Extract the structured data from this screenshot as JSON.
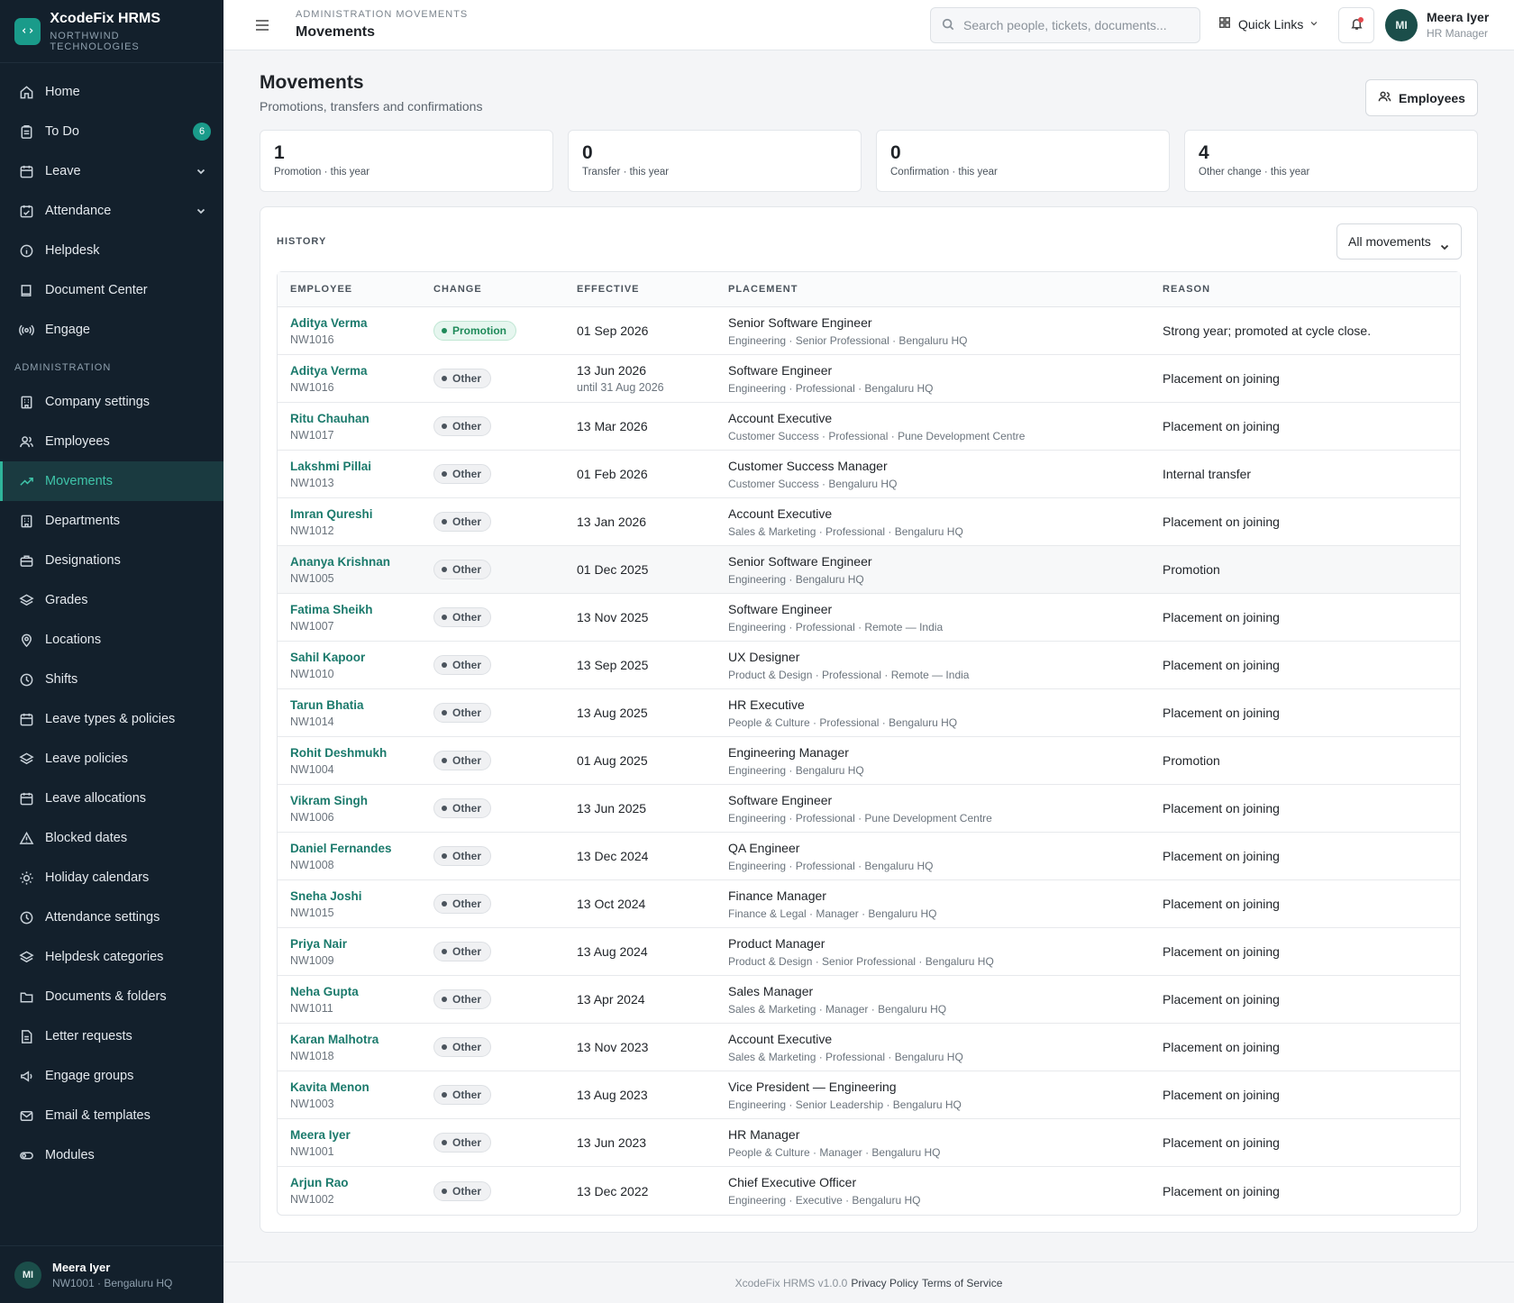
{
  "brand": {
    "name": "XcodeFix HRMS",
    "org": "NORTHWIND TECHNOLOGIES",
    "logo": "‹›"
  },
  "sidebar": {
    "items": [
      {
        "label": "Home",
        "icon": "home-icon"
      },
      {
        "label": "To Do",
        "icon": "clipboard-icon",
        "badge": "6"
      },
      {
        "label": "Leave",
        "icon": "calendar-icon",
        "expandable": true
      },
      {
        "label": "Attendance",
        "icon": "calendar-check-icon",
        "expandable": true
      },
      {
        "label": "Helpdesk",
        "icon": "info-icon"
      },
      {
        "label": "Document Center",
        "icon": "book-icon"
      },
      {
        "label": "Engage",
        "icon": "broadcast-icon"
      }
    ],
    "section_label": "ADMINISTRATION",
    "admin_items": [
      {
        "label": "Company settings",
        "icon": "building-icon"
      },
      {
        "label": "Employees",
        "icon": "users-icon"
      },
      {
        "label": "Movements",
        "icon": "trending-up-icon",
        "active": true
      },
      {
        "label": "Departments",
        "icon": "building-icon"
      },
      {
        "label": "Designations",
        "icon": "briefcase-icon"
      },
      {
        "label": "Grades",
        "icon": "layers-icon"
      },
      {
        "label": "Locations",
        "icon": "map-pin-icon"
      },
      {
        "label": "Shifts",
        "icon": "clock-icon"
      },
      {
        "label": "Leave types & policies",
        "icon": "calendar-icon"
      },
      {
        "label": "Leave policies",
        "icon": "layers-icon"
      },
      {
        "label": "Leave allocations",
        "icon": "calendar-icon"
      },
      {
        "label": "Blocked dates",
        "icon": "alert-triangle-icon"
      },
      {
        "label": "Holiday calendars",
        "icon": "sun-icon"
      },
      {
        "label": "Attendance settings",
        "icon": "clock-icon"
      },
      {
        "label": "Helpdesk categories",
        "icon": "layers-icon"
      },
      {
        "label": "Documents & folders",
        "icon": "folder-icon"
      },
      {
        "label": "Letter requests",
        "icon": "file-icon"
      },
      {
        "label": "Engage groups",
        "icon": "megaphone-icon"
      },
      {
        "label": "Email & templates",
        "icon": "mail-icon"
      },
      {
        "label": "Modules",
        "icon": "toggle-icon"
      }
    ],
    "footer": {
      "initials": "MI",
      "name": "Meera Iyer",
      "sub": "NW1001 · Bengaluru HQ"
    }
  },
  "topbar": {
    "breadcrumb": "ADMINISTRATION MOVEMENTS",
    "title": "Movements",
    "search_placeholder": "Search people, tickets, documents...",
    "quick_links": "Quick Links",
    "user": {
      "initials": "MI",
      "name": "Meera Iyer",
      "role": "HR Manager"
    }
  },
  "page": {
    "title": "Movements",
    "subtitle": "Promotions, transfers and confirmations",
    "employees_button": "Employees"
  },
  "stats": [
    {
      "value": "1",
      "label": "Promotion · this year"
    },
    {
      "value": "0",
      "label": "Transfer · this year"
    },
    {
      "value": "0",
      "label": "Confirmation · this year"
    },
    {
      "value": "4",
      "label": "Other change · this year"
    }
  ],
  "history": {
    "heading": "HISTORY",
    "filter": "All movements",
    "columns": [
      "EMPLOYEE",
      "CHANGE",
      "EFFECTIVE",
      "PLACEMENT",
      "REASON"
    ],
    "rows": [
      {
        "name": "Aditya Verma",
        "id": "NW1016",
        "change": "Promotion",
        "date": "01 Sep 2026",
        "date_sub": "",
        "title": "Senior Software Engineer",
        "placement": "Engineering · Senior Professional · Bengaluru HQ",
        "reason": "Strong year; promoted at cycle close."
      },
      {
        "name": "Aditya Verma",
        "id": "NW1016",
        "change": "Other",
        "date": "13 Jun 2026",
        "date_sub": "until 31 Aug 2026",
        "title": "Software Engineer",
        "placement": "Engineering · Professional · Bengaluru HQ",
        "reason": "Placement on joining"
      },
      {
        "name": "Ritu Chauhan",
        "id": "NW1017",
        "change": "Other",
        "date": "13 Mar 2026",
        "date_sub": "",
        "title": "Account Executive",
        "placement": "Customer Success · Professional · Pune Development Centre",
        "reason": "Placement on joining"
      },
      {
        "name": "Lakshmi Pillai",
        "id": "NW1013",
        "change": "Other",
        "date": "01 Feb 2026",
        "date_sub": "",
        "title": "Customer Success Manager",
        "placement": "Customer Success · Bengaluru HQ",
        "reason": "Internal transfer"
      },
      {
        "name": "Imran Qureshi",
        "id": "NW1012",
        "change": "Other",
        "date": "13 Jan 2026",
        "date_sub": "",
        "title": "Account Executive",
        "placement": "Sales & Marketing · Professional · Bengaluru HQ",
        "reason": "Placement on joining"
      },
      {
        "name": "Ananya Krishnan",
        "id": "NW1005",
        "change": "Other",
        "date": "01 Dec 2025",
        "date_sub": "",
        "title": "Senior Software Engineer",
        "placement": "Engineering · Bengaluru HQ",
        "reason": "Promotion"
      },
      {
        "name": "Fatima Sheikh",
        "id": "NW1007",
        "change": "Other",
        "date": "13 Nov 2025",
        "date_sub": "",
        "title": "Software Engineer",
        "placement": "Engineering · Professional · Remote — India",
        "reason": "Placement on joining"
      },
      {
        "name": "Sahil Kapoor",
        "id": "NW1010",
        "change": "Other",
        "date": "13 Sep 2025",
        "date_sub": "",
        "title": "UX Designer",
        "placement": "Product & Design · Professional · Remote — India",
        "reason": "Placement on joining"
      },
      {
        "name": "Tarun Bhatia",
        "id": "NW1014",
        "change": "Other",
        "date": "13 Aug 2025",
        "date_sub": "",
        "title": "HR Executive",
        "placement": "People & Culture · Professional · Bengaluru HQ",
        "reason": "Placement on joining"
      },
      {
        "name": "Rohit Deshmukh",
        "id": "NW1004",
        "change": "Other",
        "date": "01 Aug 2025",
        "date_sub": "",
        "title": "Engineering Manager",
        "placement": "Engineering · Bengaluru HQ",
        "reason": "Promotion"
      },
      {
        "name": "Vikram Singh",
        "id": "NW1006",
        "change": "Other",
        "date": "13 Jun 2025",
        "date_sub": "",
        "title": "Software Engineer",
        "placement": "Engineering · Professional · Pune Development Centre",
        "reason": "Placement on joining"
      },
      {
        "name": "Daniel Fernandes",
        "id": "NW1008",
        "change": "Other",
        "date": "13 Dec 2024",
        "date_sub": "",
        "title": "QA Engineer",
        "placement": "Engineering · Professional · Bengaluru HQ",
        "reason": "Placement on joining"
      },
      {
        "name": "Sneha Joshi",
        "id": "NW1015",
        "change": "Other",
        "date": "13 Oct 2024",
        "date_sub": "",
        "title": "Finance Manager",
        "placement": "Finance & Legal · Manager · Bengaluru HQ",
        "reason": "Placement on joining"
      },
      {
        "name": "Priya Nair",
        "id": "NW1009",
        "change": "Other",
        "date": "13 Aug 2024",
        "date_sub": "",
        "title": "Product Manager",
        "placement": "Product & Design · Senior Professional · Bengaluru HQ",
        "reason": "Placement on joining"
      },
      {
        "name": "Neha Gupta",
        "id": "NW1011",
        "change": "Other",
        "date": "13 Apr 2024",
        "date_sub": "",
        "title": "Sales Manager",
        "placement": "Sales & Marketing · Manager · Bengaluru HQ",
        "reason": "Placement on joining"
      },
      {
        "name": "Karan Malhotra",
        "id": "NW1018",
        "change": "Other",
        "date": "13 Nov 2023",
        "date_sub": "",
        "title": "Account Executive",
        "placement": "Sales & Marketing · Professional · Bengaluru HQ",
        "reason": "Placement on joining"
      },
      {
        "name": "Kavita Menon",
        "id": "NW1003",
        "change": "Other",
        "date": "13 Aug 2023",
        "date_sub": "",
        "title": "Vice President — Engineering",
        "placement": "Engineering · Senior Leadership · Bengaluru HQ",
        "reason": "Placement on joining"
      },
      {
        "name": "Meera Iyer",
        "id": "NW1001",
        "change": "Other",
        "date": "13 Jun 2023",
        "date_sub": "",
        "title": "HR Manager",
        "placement": "People & Culture · Manager · Bengaluru HQ",
        "reason": "Placement on joining"
      },
      {
        "name": "Arjun Rao",
        "id": "NW1002",
        "change": "Other",
        "date": "13 Dec 2022",
        "date_sub": "",
        "title": "Chief Executive Officer",
        "placement": "Engineering · Executive · Bengaluru HQ",
        "reason": "Placement on joining"
      }
    ]
  },
  "footer": {
    "version": "XcodeFix HRMS v1.0.0",
    "privacy": "Privacy Policy",
    "terms": "Terms of Service"
  },
  "colors": {
    "sidebar_bg": "#13202c",
    "accent": "#1a9b8a",
    "active_text": "#3fc4a9",
    "link": "#1b7a6c",
    "promotion": "#1f8a5a"
  }
}
